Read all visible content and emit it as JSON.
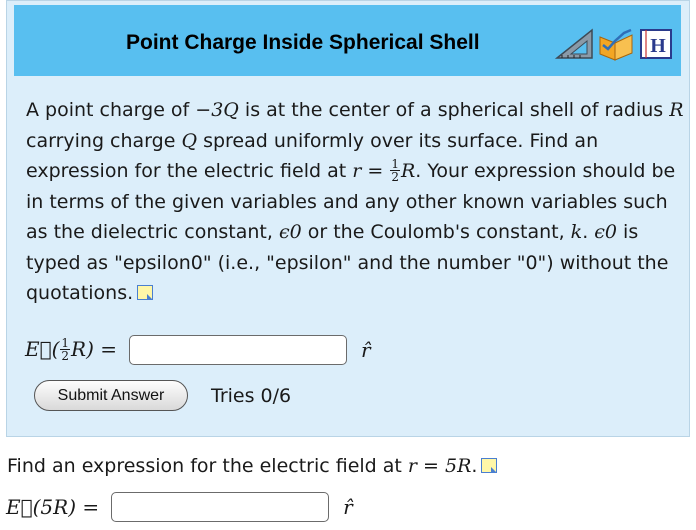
{
  "header": {
    "title": "Point Charge Inside Spherical Shell",
    "icons": [
      "triangle-ruler-icon",
      "book-orange-icon",
      "hint-icon"
    ],
    "hint_icon_text": "H"
  },
  "problem": {
    "t1": "A point charge of ",
    "charge": "−3Q",
    "t2": " is at the center of a spherical shell of radius ",
    "R": "R",
    "t3": " carrying charge ",
    "Q": "Q",
    "t4": " spread uniformly over its surface. Find an expression for the electric field at ",
    "r_eq": "r = ",
    "frac_num": "1",
    "frac_den": "2",
    "R2": "R",
    "t5": ". Your expression should be in terms of the given variables and any other known variables such as the dielectric constant, ",
    "eps": "ϵ0",
    "t6": " or the Coulomb's constant, ",
    "k": "k",
    "t7": ". ",
    "eps2": "ϵ0",
    "t8": " is typed as \"epsilon0\" (i.e., \"epsilon\" and the number \"0\") without the quotations."
  },
  "part1": {
    "label_pre": "E⃗(",
    "frac_num": "1",
    "frac_den": "2",
    "label_post": "R) =",
    "value": "",
    "unit": "r̂",
    "submit_label": "Submit Answer",
    "tries": "Tries 0/6"
  },
  "part2": {
    "t1": "Find an expression for the electric field at ",
    "r_eq": "r = 5R",
    "t2": ".",
    "label": "E⃗(5R) =",
    "value": "",
    "unit": "r̂"
  },
  "colors": {
    "panel_bg": "#dceefa",
    "header_bg": "#58bff0",
    "note_icon_fill": "#fff7a8",
    "note_icon_border": "#4a7fd0"
  }
}
